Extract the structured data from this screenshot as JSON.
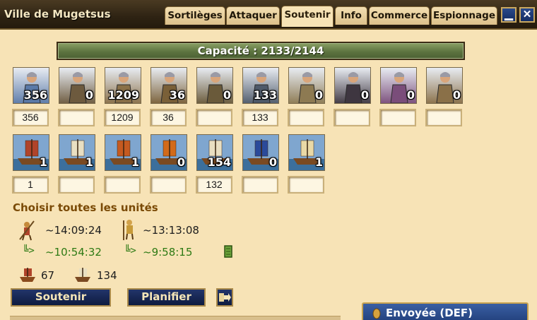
{
  "window": {
    "title": "Ville de Mugetsus",
    "tabs": [
      {
        "label": "Sortilèges"
      },
      {
        "label": "Attaquer"
      },
      {
        "label": "Soutenir"
      },
      {
        "label": "Info"
      },
      {
        "label": "Commerce"
      },
      {
        "label": "Espionnage"
      }
    ],
    "active_tab": "Soutenir",
    "minimize_glyph": "▁",
    "close_glyph": "✕"
  },
  "capacity": {
    "label": "Capacité : 2133/2144",
    "used": 2133,
    "max": 2144
  },
  "land_units": [
    {
      "icon": "swordsman-icon",
      "count": "356",
      "input": "356"
    },
    {
      "icon": "slinger-icon",
      "count": "0",
      "input": ""
    },
    {
      "icon": "archer-icon",
      "count": "1209",
      "input": "1209"
    },
    {
      "icon": "hoplite-icon",
      "count": "36",
      "input": "36"
    },
    {
      "icon": "horseman-icon",
      "count": "0",
      "input": ""
    },
    {
      "icon": "chariot-icon",
      "count": "133",
      "input": "133"
    },
    {
      "icon": "catapult-icon",
      "count": "0",
      "input": ""
    },
    {
      "icon": "manticore-icon",
      "count": "0",
      "input": ""
    },
    {
      "icon": "siren-icon",
      "count": "0",
      "input": ""
    },
    {
      "icon": "hero-icon",
      "count": "0",
      "input": ""
    }
  ],
  "naval_units": [
    {
      "icon": "transport-boat-icon",
      "count": "1",
      "input": "1"
    },
    {
      "icon": "bireme-icon",
      "count": "1",
      "input": ""
    },
    {
      "icon": "attack-ship-icon",
      "count": "1",
      "input": ""
    },
    {
      "icon": "fire-ship-icon",
      "count": "0",
      "input": ""
    },
    {
      "icon": "fast-transport-icon",
      "count": "154",
      "input": "132"
    },
    {
      "icon": "trireme-icon",
      "count": "0",
      "input": ""
    },
    {
      "icon": "colony-ship-icon",
      "count": "1",
      "input": ""
    }
  ],
  "select_all": "Choisir toutes les unités",
  "travel": {
    "time1": "~14:09:24",
    "time2": "~13:13:08",
    "arrival_prefix": "╚>",
    "arrival1": "~10:54:32",
    "arrival2": "~9:58:15"
  },
  "ships": [
    {
      "icon": "slow-ship-icon",
      "value": "67"
    },
    {
      "icon": "fast-ship-icon",
      "value": "134"
    }
  ],
  "buttons": {
    "support": "Soutenir",
    "plan": "Planifier"
  },
  "sent_panel": "Envoyée (DEF)"
}
